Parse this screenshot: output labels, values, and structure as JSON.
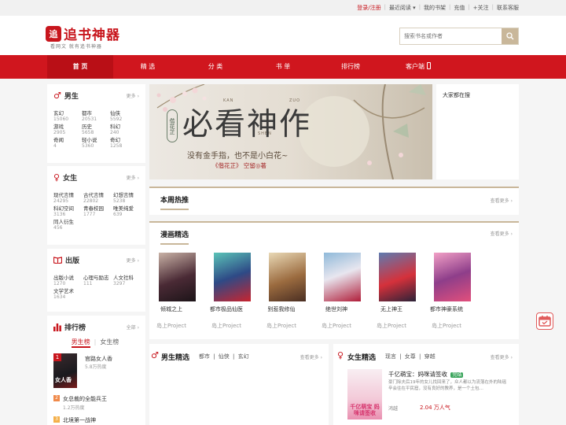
{
  "topbar": {
    "links": [
      "登录/注册",
      "最近阅读 ▾",
      "我的书架",
      "充值",
      "+关注",
      "联系客服"
    ]
  },
  "logo": {
    "mark": "追",
    "text": "追书神器",
    "slogan": "看网文 就有追书神器"
  },
  "search": {
    "placeholder": "搜索书名或作者"
  },
  "nav": {
    "items": [
      "首 页",
      "精 选",
      "分 类",
      "书 单",
      "排行榜",
      "客户端"
    ]
  },
  "male": {
    "title": "男生",
    "more": "更多",
    "cats": [
      {
        "name": "玄幻",
        "count": "15060"
      },
      {
        "name": "都市",
        "count": "20531"
      },
      {
        "name": "仙侠",
        "count": "5592"
      },
      {
        "name": "游戏",
        "count": "2905"
      },
      {
        "name": "历史",
        "count": "5658"
      },
      {
        "name": "科幻",
        "count": "240"
      },
      {
        "name": "奇闻",
        "count": "4"
      },
      {
        "name": "轻小说",
        "count": "5360"
      },
      {
        "name": "奇幻",
        "count": "1258"
      }
    ]
  },
  "female": {
    "title": "女生",
    "more": "更多",
    "cats": [
      {
        "name": "现代言情",
        "count": "24295"
      },
      {
        "name": "古代言情",
        "count": "22802"
      },
      {
        "name": "幻想言情",
        "count": "5238"
      },
      {
        "name": "科幻空间",
        "count": "3136"
      },
      {
        "name": "青春校园",
        "count": "1777"
      },
      {
        "name": "唯美纯爱",
        "count": "639"
      },
      {
        "name": "同人衍生",
        "count": "456"
      }
    ]
  },
  "publish": {
    "title": "出版",
    "more": "更多",
    "cats": [
      {
        "name": "出版小说",
        "count": "1270"
      },
      {
        "name": "心理与励志",
        "count": "111"
      },
      {
        "name": "人文社科",
        "count": "3297"
      },
      {
        "name": "文学艺术",
        "count": "1634"
      }
    ]
  },
  "rank": {
    "title": "排行榜",
    "all": "全部",
    "tab_male": "男生榜",
    "tab_female": "女生榜",
    "cover_text": "女人香",
    "items": [
      {
        "num": "1",
        "title": "官路女人香",
        "heat": "5.8万热度"
      },
      {
        "num": "2",
        "title": "女总裁的全能兵王",
        "heat": "1.2万热度"
      },
      {
        "num": "3",
        "title": "北境第一战神",
        "heat": ""
      }
    ]
  },
  "banner": {
    "title": "必看神作",
    "pinyin": [
      "KAN",
      "BI",
      "ZUO",
      "SHEN"
    ],
    "subtitle": "没有金手指，也不是小白花~",
    "credit": "《偕花芷》 空留◎著",
    "seal": "偕花芷"
  },
  "hotsearch": {
    "title": "大家都在搜"
  },
  "weekly": {
    "title": "本周热推",
    "more": "查看更多"
  },
  "manga": {
    "title": "漫画精选",
    "more": "查看更多",
    "items": [
      {
        "name": "倾城之上",
        "author": "岛上Project"
      },
      {
        "name": "都市极品仙医",
        "author": "岛上Project"
      },
      {
        "name": "别惹我修仙",
        "author": "岛上Project"
      },
      {
        "name": "绝世刘神",
        "author": "岛上Project"
      },
      {
        "name": "无上神王",
        "author": "岛上Project"
      },
      {
        "name": "都市神豪系统",
        "author": "岛上Project"
      }
    ]
  },
  "male_pick": {
    "title": "男生精选",
    "tabs": "都市 | 仙侠 | 玄幻",
    "more": "查看更多"
  },
  "female_pick": {
    "title": "女生精选",
    "tabs": "现言 | 女尊 | 穿越",
    "more": "查看更多",
    "book": {
      "title": "千亿萌宝：妈咪请签收",
      "badge": "完结",
      "desc": "豪门除夫后19年的女儿找回来了，众人都以为流落在外的陆瑶辛会往在平民窟，没有良好的教养，是一个土包…",
      "author": "鸿越",
      "popularity": "2.04 万人气",
      "cover_text": "千亿萌宝 妈咪请签收"
    }
  },
  "colors": {
    "brand": "#d0161e",
    "gold": "#c9b79a"
  }
}
